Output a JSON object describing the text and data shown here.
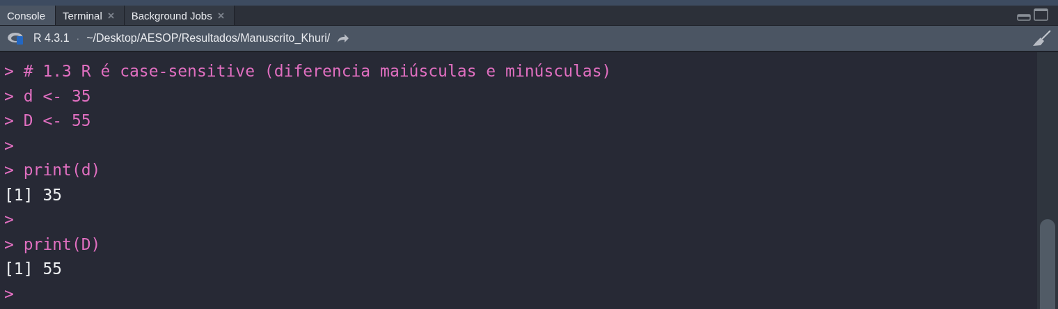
{
  "tabs": [
    {
      "label": "Console",
      "selected": true,
      "closable": false
    },
    {
      "label": "Terminal",
      "selected": false,
      "closable": true
    },
    {
      "label": "Background Jobs",
      "selected": false,
      "closable": true
    }
  ],
  "header": {
    "version": "R 4.3.1",
    "separator": "·",
    "path": "~/Desktop/AESOP/Resultados/Manuscrito_Khuri/"
  },
  "console_lines": [
    {
      "kind": "input",
      "prompt": ">",
      "text": "# 1.3 R é case-sensitive (diferencia maiúsculas e minúsculas)"
    },
    {
      "kind": "input",
      "prompt": ">",
      "text": "d <- 35"
    },
    {
      "kind": "input",
      "prompt": ">",
      "text": "D <- 55"
    },
    {
      "kind": "input",
      "prompt": ">"
    },
    {
      "kind": "input",
      "prompt": ">",
      "text": "print(d)"
    },
    {
      "kind": "output",
      "text": "[1] 35"
    },
    {
      "kind": "input",
      "prompt": ">"
    },
    {
      "kind": "input",
      "prompt": ">",
      "text": "print(D)"
    },
    {
      "kind": "output",
      "text": "[1] 55"
    },
    {
      "kind": "input",
      "prompt": ">"
    }
  ]
}
